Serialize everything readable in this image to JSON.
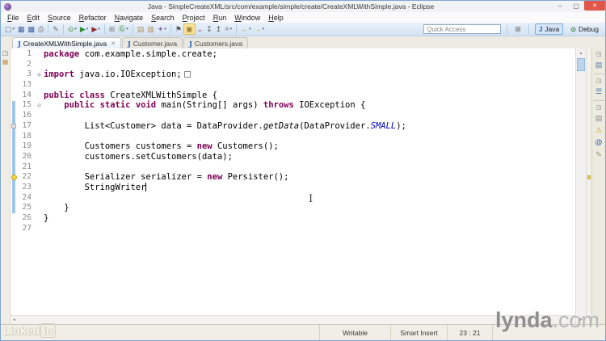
{
  "window": {
    "title": "Java - SimpleCreateXML/src/com/example/simple/create/CreateXMLWithSimple.java - Eclipse",
    "minimize_label": "–",
    "maximize_label": "▢",
    "close_label": "✕"
  },
  "menu": {
    "items": [
      "File",
      "Edit",
      "Source",
      "Refactor",
      "Navigate",
      "Search",
      "Project",
      "Run",
      "Window",
      "Help"
    ]
  },
  "toolbar": {
    "quick_access_placeholder": "Quick Access",
    "open_perspective_glyph": "⊞",
    "perspectives": [
      {
        "label": "Java",
        "glyph": "J",
        "glyph_color": "#1b5fa8",
        "active": true
      },
      {
        "label": "Debug",
        "glyph": "⊙",
        "glyph_color": "#3a7d3a",
        "active": false
      }
    ],
    "icons": [
      {
        "name": "new-wizard-icon",
        "glyph": "▢",
        "color": "#6d6d6d",
        "dropdown": true
      },
      {
        "name": "save-icon",
        "glyph": "▦",
        "color": "#41609c"
      },
      {
        "name": "save-all-icon",
        "glyph": "▩",
        "color": "#41609c"
      },
      {
        "name": "print-icon",
        "glyph": "⎙",
        "color": "#5a5a5a"
      },
      {
        "sep": true
      },
      {
        "name": "pencil-icon",
        "glyph": "✎",
        "color": "#6b6b6b"
      },
      {
        "sep": true
      },
      {
        "name": "debug-icon",
        "glyph": "⊙",
        "color": "#3a8a3a",
        "dropdown": true
      },
      {
        "name": "run-icon",
        "glyph": "▶",
        "color": "#2e8b2e",
        "dropdown": true
      },
      {
        "name": "coverage-icon",
        "glyph": "▶",
        "color": "#8f2d2d",
        "dropdown": true
      },
      {
        "sep": true
      },
      {
        "name": "grid-icon",
        "glyph": "⊞",
        "color": "#7a7a7a"
      },
      {
        "name": "letter-g-icon",
        "glyph": "Ⓖ",
        "color": "#2f7d32",
        "dropdown": true
      },
      {
        "sep": true
      },
      {
        "name": "open-folder-icon",
        "glyph": "▤",
        "color": "#b08d57"
      },
      {
        "name": "new-folder-icon",
        "glyph": "▥",
        "color": "#b08d57"
      },
      {
        "name": "wand-icon",
        "glyph": "✦",
        "color": "#8a6fa0",
        "dropdown": true
      },
      {
        "sep": true
      },
      {
        "name": "flag-icon",
        "glyph": "⚑",
        "color": "#555555"
      },
      {
        "name": "mark-occurrences-icon",
        "glyph": "▣",
        "color": "#9a7d2e",
        "active": true
      },
      {
        "name": "down-arrow-icon",
        "glyph": "⌄",
        "color": "#a03333"
      },
      {
        "name": "next-annotation-icon",
        "glyph": "↧",
        "color": "#555555"
      },
      {
        "name": "prev-annotation-icon",
        "glyph": "↥",
        "color": "#555555"
      },
      {
        "name": "pin-icon",
        "glyph": "⍟",
        "color": "#777777",
        "dropdown": true
      },
      {
        "sep": true
      },
      {
        "name": "back-icon",
        "glyph": "←",
        "color": "#c9a227",
        "dropdown": true
      },
      {
        "name": "forward-icon",
        "glyph": "→",
        "color": "#c9a227",
        "dropdown": true
      }
    ]
  },
  "tabs": [
    {
      "label": "CreateXMLWithSimple.java",
      "active": true,
      "closable": true
    },
    {
      "label": "Customer.java",
      "active": false,
      "closable": false
    },
    {
      "label": "Customers.java",
      "active": false,
      "closable": false
    }
  ],
  "editor": {
    "left_trim_icons": [
      {
        "name": "restore-view-icon",
        "glyph": "◳",
        "color": "#777777"
      },
      {
        "name": "package-explorer-view-icon",
        "glyph": "▦",
        "color": "#c49a4a"
      }
    ],
    "range": {
      "start_line": "15",
      "end_line": "25"
    },
    "lines": [
      {
        "n": "1",
        "tokens": [
          {
            "c": "k",
            "t": "package"
          },
          {
            "c": "p",
            "t": " com.example.simple.create;"
          }
        ]
      },
      {
        "n": "2",
        "tokens": []
      },
      {
        "n": "3",
        "fold": "collapsed",
        "tokens": [
          {
            "c": "k",
            "t": "import"
          },
          {
            "c": "p",
            "t": " java.io.IOException;"
          },
          {
            "c": "foldbox"
          }
        ]
      },
      {
        "n": "13",
        "tokens": []
      },
      {
        "n": "14",
        "tokens": [
          {
            "c": "k",
            "t": "public"
          },
          {
            "c": "p",
            "t": " "
          },
          {
            "c": "k",
            "t": "class"
          },
          {
            "c": "p",
            "t": " CreateXMLWithSimple {"
          }
        ]
      },
      {
        "n": "15",
        "fold": "expanded",
        "tokens": [
          {
            "c": "p",
            "t": "    "
          },
          {
            "c": "k",
            "t": "public"
          },
          {
            "c": "p",
            "t": " "
          },
          {
            "c": "k",
            "t": "static"
          },
          {
            "c": "p",
            "t": " "
          },
          {
            "c": "k",
            "t": "void"
          },
          {
            "c": "p",
            "t": " main(String[] args) "
          },
          {
            "c": "k",
            "t": "throws"
          },
          {
            "c": "p",
            "t": " IOException {"
          }
        ]
      },
      {
        "n": "16",
        "tokens": []
      },
      {
        "n": "17",
        "marker": "task",
        "tokens": [
          {
            "c": "p",
            "t": "        List<Customer> data = DataProvider."
          },
          {
            "c": "sm",
            "t": "getData"
          },
          {
            "c": "p",
            "t": "(DataProvider."
          },
          {
            "c": "sf",
            "t": "SMALL"
          },
          {
            "c": "p",
            "t": ");"
          }
        ]
      },
      {
        "n": "18",
        "tokens": []
      },
      {
        "n": "19",
        "tokens": [
          {
            "c": "p",
            "t": "        Customers customers = "
          },
          {
            "c": "k",
            "t": "new"
          },
          {
            "c": "p",
            "t": " Customers();"
          }
        ]
      },
      {
        "n": "20",
        "tokens": [
          {
            "c": "p",
            "t": "        customers.setCustomers(data);"
          }
        ]
      },
      {
        "n": "21",
        "tokens": []
      },
      {
        "n": "22",
        "marker": "bulb",
        "tokens": [
          {
            "c": "p",
            "t": "        Serializer serializer = "
          },
          {
            "c": "k",
            "t": "new"
          },
          {
            "c": "p",
            "t": " Persister();"
          }
        ]
      },
      {
        "n": "23",
        "caret_line": true,
        "tokens": [
          {
            "c": "p",
            "t": "        StringWriter"
          },
          {
            "c": "caret"
          }
        ]
      },
      {
        "n": "24",
        "tokens": []
      },
      {
        "n": "25",
        "tokens": [
          {
            "c": "p",
            "t": "    }"
          }
        ]
      },
      {
        "n": "26",
        "tokens": [
          {
            "c": "p",
            "t": "}"
          }
        ]
      },
      {
        "n": "27",
        "tokens": []
      }
    ],
    "right_trim_groups": [
      {
        "icons": [
          {
            "name": "restore-view-icon",
            "glyph": "◳",
            "color": "#777777",
            "small": true
          },
          {
            "name": "task-list-view-icon",
            "glyph": "▤",
            "color": "#5a7da5"
          }
        ]
      },
      {
        "icons": [
          {
            "name": "restore-view-icon",
            "glyph": "◳",
            "color": "#777777",
            "small": true
          },
          {
            "name": "outline-view-icon",
            "glyph": "☰",
            "color": "#3b6fae"
          }
        ]
      },
      {
        "icons": [
          {
            "name": "restore-view-icon",
            "glyph": "◳",
            "color": "#777777",
            "small": true
          },
          {
            "name": "tasks-view-icon",
            "glyph": "▤",
            "color": "#888888"
          },
          {
            "name": "problems-view-icon",
            "glyph": "⚠",
            "color": "#c59f1f"
          },
          {
            "name": "javadoc-view-icon",
            "glyph": "@",
            "color": "#3465a4"
          },
          {
            "name": "declaration-view-icon",
            "glyph": "✎",
            "color": "#999966"
          }
        ]
      }
    ]
  },
  "status": {
    "writable": "Writable",
    "insert_mode": "Smart Insert",
    "cursor_position": "23 : 21"
  },
  "watermarks": {
    "left_text": "Linked",
    "left_badge": "in",
    "right_bold": "lynda",
    "right_light": ".com"
  },
  "cursor": {
    "ibeam_glyph": "I"
  },
  "colors": {
    "keyword": "#7f0055",
    "static_field": "#0000c0",
    "range_indicator": "#9fc6e8",
    "toolbar_top": "#eaf2fb",
    "toolbar_bottom": "#d2e2f2",
    "close_button": "#e0564a",
    "trim_background": "#edeae0"
  }
}
